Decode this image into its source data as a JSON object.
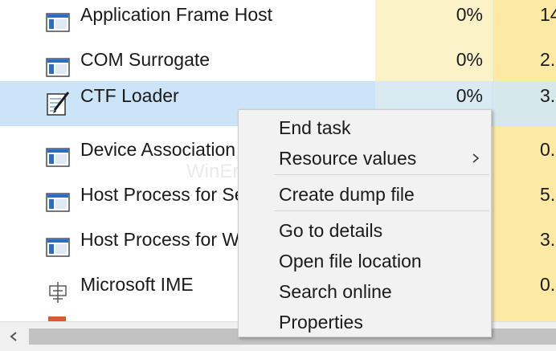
{
  "processes": [
    {
      "name": "Application Frame Host",
      "cpu": "0%",
      "memory": "14.",
      "icon": "app-window-icon"
    },
    {
      "name": "COM Surrogate",
      "cpu": "0%",
      "memory": "2.",
      "icon": "app-window-icon"
    },
    {
      "name": "CTF Loader",
      "cpu": "0%",
      "memory": "3.",
      "icon": "notepad-pen-icon",
      "selected": true
    },
    {
      "name": "Device Association",
      "cpu": "",
      "memory": "0.",
      "icon": "app-window-icon"
    },
    {
      "name": "Host Process for Se",
      "cpu": "",
      "memory": "5.",
      "icon": "app-window-icon"
    },
    {
      "name": "Host Process for W",
      "cpu": "",
      "memory": "3.",
      "icon": "app-window-icon"
    },
    {
      "name": "Microsoft IME",
      "cpu": "",
      "memory": "0.",
      "icon": "ime-icon"
    }
  ],
  "context_menu": {
    "items": [
      {
        "label": "End task"
      },
      {
        "label": "Resource values",
        "has_submenu": true
      },
      {
        "label": "Create dump file"
      },
      {
        "label": "Go to details"
      },
      {
        "label": "Open file location"
      },
      {
        "label": "Search online"
      },
      {
        "label": "Properties"
      }
    ]
  },
  "watermark": "WinErrorFixer.Com",
  "colors": {
    "selected_row": "#cce4f7",
    "cpu_column": "#fcf2c7",
    "memory_column": "#fbe9a4",
    "menu_background": "#f2f2f2"
  }
}
